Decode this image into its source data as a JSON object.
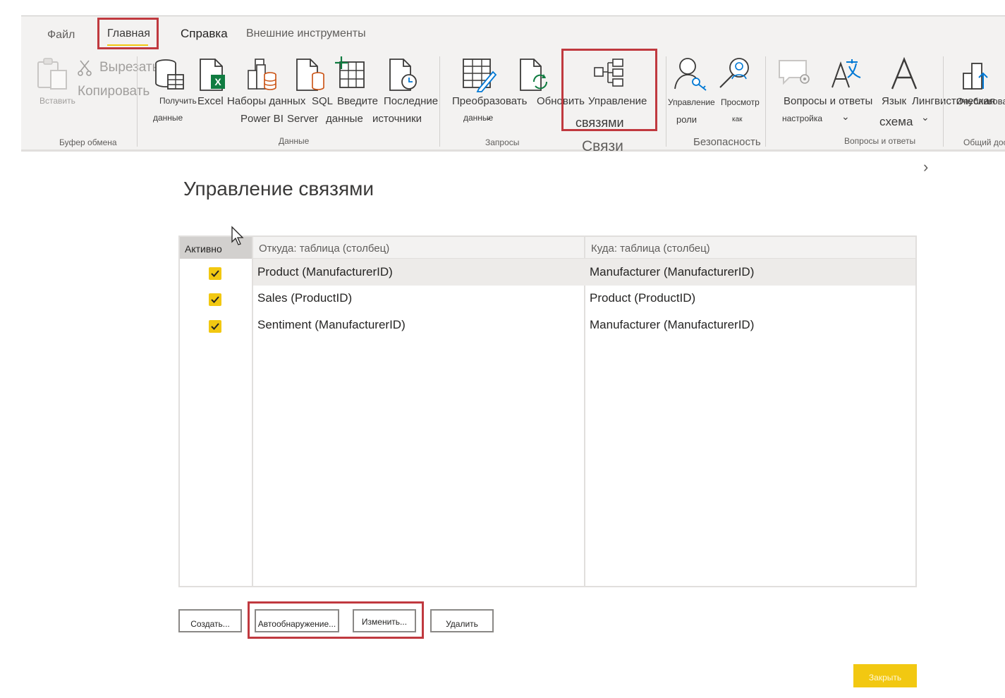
{
  "tabs": {
    "file": "Файл",
    "home": "Главная",
    "help": "Справка",
    "external": "Внешние инструменты"
  },
  "ribbon": {
    "clipboard": {
      "paste": "Вставить",
      "cut": "Вырезать",
      "copy": "Копировать",
      "group": "Буфер обмена"
    },
    "data": {
      "get_data_1": "Получить",
      "get_data_2": "данные",
      "excel": "Excel",
      "datasets_1": "Наборы данных",
      "datasets_2": "Power BI",
      "sql_1": "SQL",
      "sql_2": "Server",
      "enter_1": "Введите",
      "enter_2": "данные",
      "recent_1": "Последние",
      "recent_2": "источники",
      "group": "Данные"
    },
    "queries": {
      "transform_1": "Преобразовать",
      "transform_2": "данные",
      "refresh": "Обновить",
      "group": "Запросы"
    },
    "relationships": {
      "manage_1": "Управление",
      "manage_2": "связями",
      "group": "Связи"
    },
    "security": {
      "manage_roles_1": "Управление",
      "manage_roles_2": "роли",
      "view_as_1": "Просмотр",
      "view_as_2": "как",
      "group": "Безопасность"
    },
    "qa": {
      "qa_1": "Вопросы и ответы",
      "qa_2": "настройка",
      "language": "Язык",
      "linguistic_1": "Лингвистическая",
      "linguistic_2": "схема",
      "group": "Вопросы и ответы"
    },
    "share": {
      "publish": "Опубликовать",
      "group": "Общий доступ"
    }
  },
  "dialog": {
    "title": "Управление связями",
    "columns": {
      "active": "Активно",
      "from": "Откуда: таблица (столбец)",
      "to": "Куда: таблица (столбец)"
    },
    "rows": [
      {
        "from": "Product (ManufacturerID)",
        "to": "Manufacturer (ManufacturerID)"
      },
      {
        "from": "Sales (ProductID)",
        "to": "Product (ProductID)"
      },
      {
        "from": "Sentiment (ManufacturerID)",
        "to": "Manufacturer (ManufacturerID)"
      }
    ],
    "buttons": {
      "new": "Создать...",
      "autodetect": "Автообнаружение...",
      "edit": "Изменить...",
      "delete": "Удалить",
      "close": "Закрыть"
    }
  },
  "colors": {
    "accent_yellow": "#f2c811",
    "highlight_red": "#c0393f",
    "ribbon_bg": "#f3f2f1"
  }
}
